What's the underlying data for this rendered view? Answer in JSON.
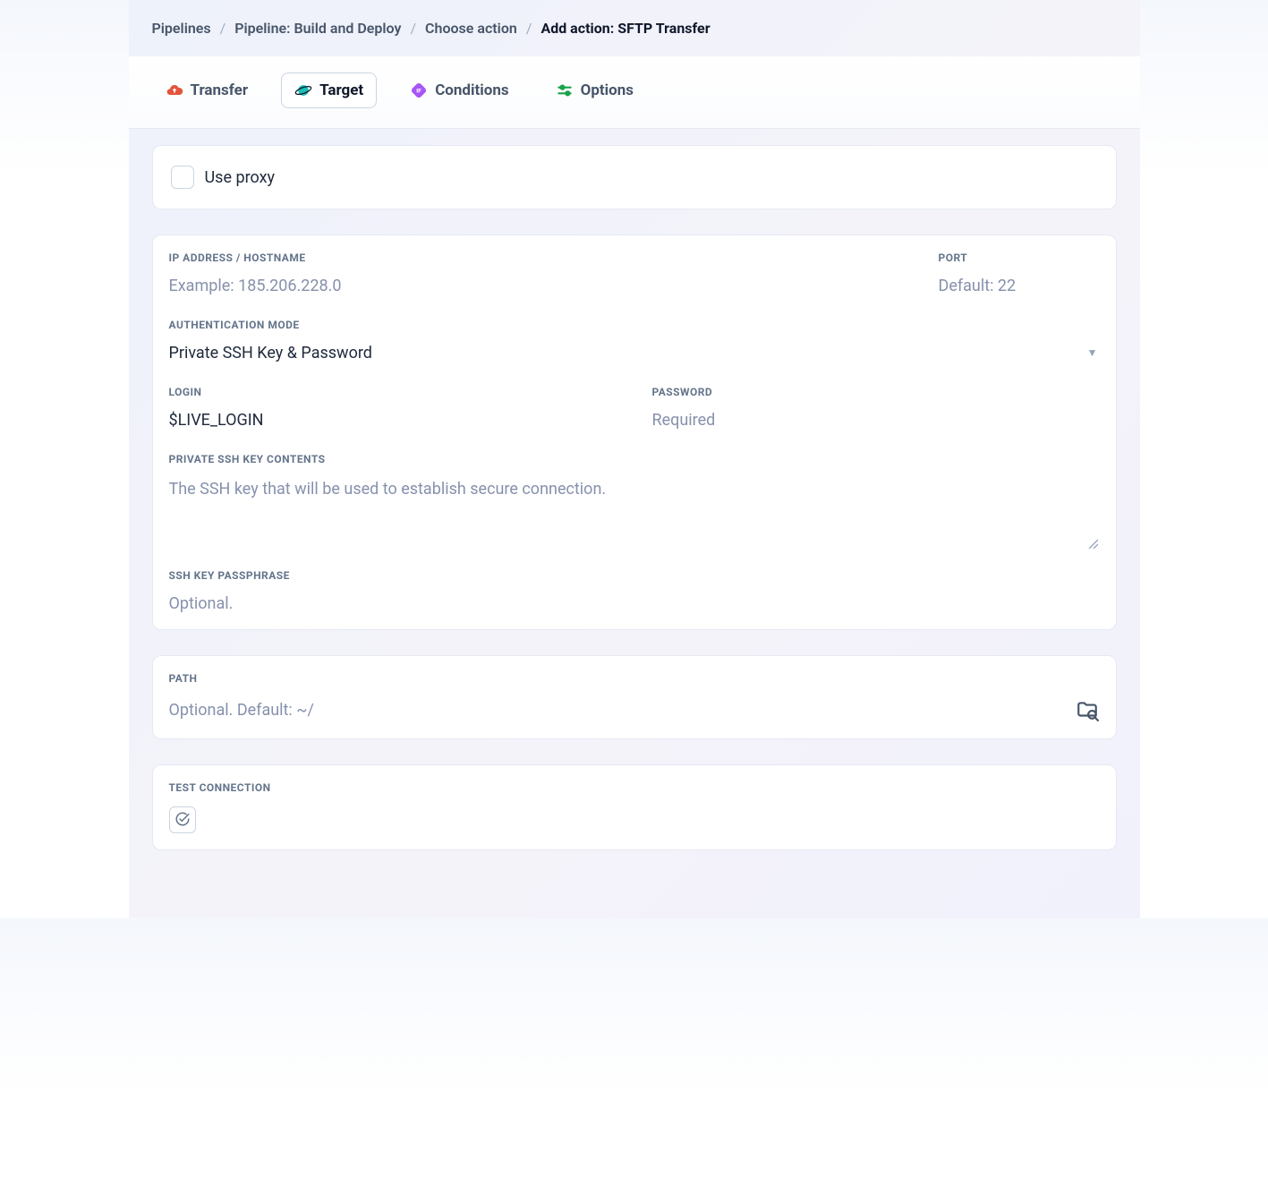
{
  "breadcrumb": {
    "items": [
      {
        "label": "Pipelines"
      },
      {
        "label": "Pipeline: Build and Deploy"
      },
      {
        "label": "Choose action"
      }
    ],
    "current": "Add action: SFTP Transfer"
  },
  "tabs": {
    "transfer": "Transfer",
    "target": "Target",
    "conditions": "Conditions",
    "options": "Options"
  },
  "proxy": {
    "label": "Use proxy",
    "checked": false
  },
  "form": {
    "ip_label": "IP ADDRESS / HOSTNAME",
    "ip_placeholder": "Example: 185.206.228.0",
    "ip_value": "",
    "port_label": "PORT",
    "port_placeholder": "Default: 22",
    "port_value": "",
    "auth_label": "AUTHENTICATION MODE",
    "auth_value": "Private SSH Key & Password",
    "login_label": "LOGIN",
    "login_value": "$LIVE_LOGIN",
    "password_label": "PASSWORD",
    "password_placeholder": "Required",
    "password_value": "",
    "sshkey_label": "PRIVATE SSH KEY CONTENTS",
    "sshkey_placeholder": "The SSH key that will be used to establish secure connection.",
    "sshkey_value": "",
    "passphrase_label": "SSH KEY PASSPHRASE",
    "passphrase_placeholder": "Optional.",
    "passphrase_value": "",
    "path_label": "PATH",
    "path_placeholder": "Optional. Default: ~/",
    "path_value": "",
    "test_label": "TEST CONNECTION"
  }
}
